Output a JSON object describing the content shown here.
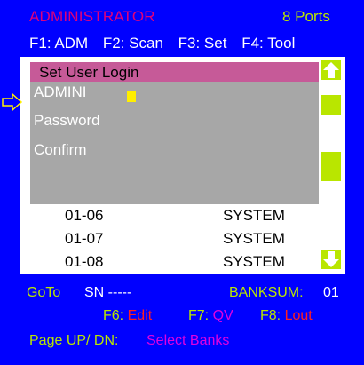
{
  "header": {
    "title": "ADMINISTRATOR",
    "ports": "8 Ports",
    "function_keys": [
      "F1: ADM",
      "F2: Scan",
      "F3: Set",
      "F4: Tool"
    ]
  },
  "dialog": {
    "title": "Set User Login",
    "username_value": "ADMINI",
    "password_label": "Password",
    "confirm_label": "Confirm"
  },
  "ports": [
    {
      "number": "01-06",
      "name": "SYSTEM"
    },
    {
      "number": "01-07",
      "name": "SYSTEM"
    },
    {
      "number": "01-08",
      "name": "SYSTEM"
    }
  ],
  "footer": {
    "goto_label": "GoTo",
    "sn_value": "SN -----",
    "banksum_label": "BANKSUM:",
    "banksum_value": "01",
    "f6_key": "F6:",
    "f6_action": "Edit",
    "f7_key": "F7:",
    "f7_action": "QV",
    "f8_key": "F8:",
    "f8_action": "Lout",
    "page_label": "Page UP/ DN:",
    "page_action": "Select Banks"
  },
  "colors": {
    "background": "#0000ff",
    "accent_yellow_green": "#b9e600",
    "title_magenta": "#e0007a",
    "dialog_header": "#c65a98",
    "dialog_body": "#a7a7a7",
    "cursor_yellow": "#ffef00",
    "action_red": "#ff2020",
    "action_magenta": "#e000e0"
  },
  "icons": [
    "arrow-up-icon",
    "arrow-down-icon",
    "pointer-arrow-icon",
    "text-cursor-block"
  ]
}
